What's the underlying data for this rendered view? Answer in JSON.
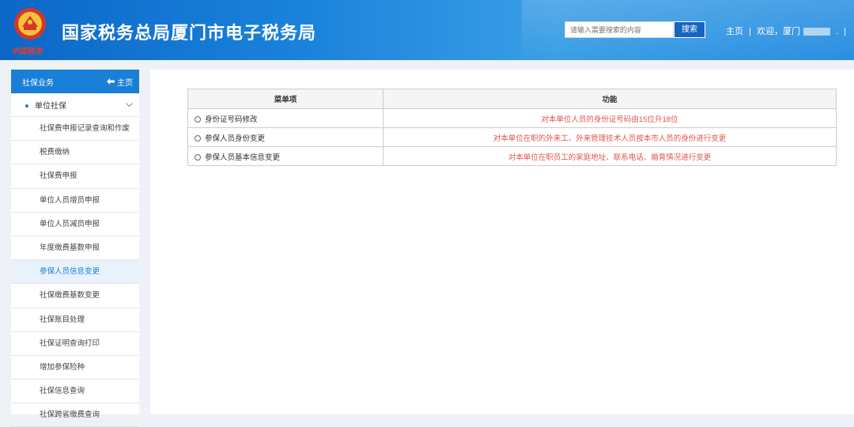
{
  "header": {
    "title": "国家税务总局厦门市电子税务局",
    "emblem_text": "中国税务",
    "search_placeholder": "请输入需要搜索的内容",
    "search_button": "搜索",
    "home_link": "主页",
    "separator": "|",
    "welcome": "欢迎，厦门",
    "welcome_tail": ".",
    "colors": {
      "brand": "#1a7fd8",
      "search_button": "#1565c0"
    }
  },
  "sidebar": {
    "title": "社保业务",
    "home_label": "主页",
    "group_label": "单位社保",
    "items": [
      {
        "label": "社保费申报记录查询和作废",
        "active": false
      },
      {
        "label": "税费缴纳",
        "active": false
      },
      {
        "label": "社保费申报",
        "active": false
      },
      {
        "label": "单位人员增员申报",
        "active": false
      },
      {
        "label": "单位人员减员申报",
        "active": false
      },
      {
        "label": "年度缴费基数申报",
        "active": false
      },
      {
        "label": "参保人员信息变更",
        "active": true
      },
      {
        "label": "社保缴费基数变更",
        "active": false
      },
      {
        "label": "社保账目处理",
        "active": false
      },
      {
        "label": "社保证明查询打印",
        "active": false
      },
      {
        "label": "增加参保险种",
        "active": false
      },
      {
        "label": "社保信息查询",
        "active": false
      },
      {
        "label": "社保跨省缴费查询",
        "active": false
      }
    ]
  },
  "table": {
    "headers": [
      "菜单项",
      "功能"
    ],
    "rows": [
      {
        "option": "身份证号码修改",
        "description": "对本单位人员的身份证号码由15位升18位"
      },
      {
        "option": "参保人员身份变更",
        "description": "对本单位在职的外来工、外来管理技术人员按本市人员的身份进行变更"
      },
      {
        "option": "参保人员基本信息变更",
        "description": "对本单位在职员工的家庭地址、联系电话、婚育情况进行变更"
      }
    ],
    "colors": {
      "description_text": "#e0564a"
    }
  }
}
